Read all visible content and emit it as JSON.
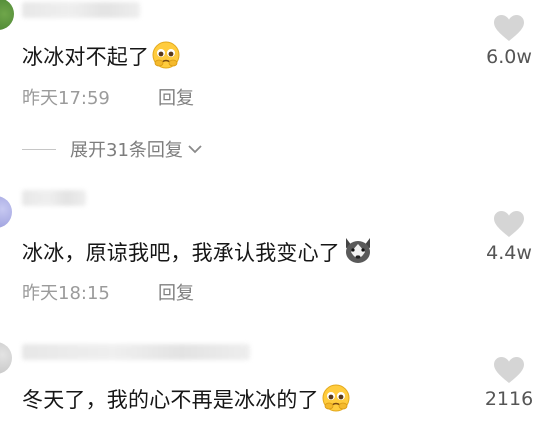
{
  "comments": [
    {
      "text": "冰冰对不起了",
      "emoji_icon": "pleading-face-emoji",
      "time": "昨天17:59",
      "reply_label": "回复",
      "likes": "6.0w",
      "expand_label": "展开31条回复"
    },
    {
      "text": "冰冰，原谅我吧，我承认我变心了",
      "emoji_icon": "husky-dog-emoji",
      "time": "昨天18:15",
      "reply_label": "回复",
      "likes": "4.4w"
    },
    {
      "text": "冬天了，我的心不再是冰冰的了",
      "emoji_icon": "pleading-face-emoji",
      "likes": "2116"
    }
  ],
  "colors": {
    "text": "#161616",
    "meta": "#9b9b9b",
    "heart": "#d5d5d5",
    "background": "#ffffff"
  },
  "icons": [
    "heart-icon",
    "chevron-down-icon"
  ]
}
